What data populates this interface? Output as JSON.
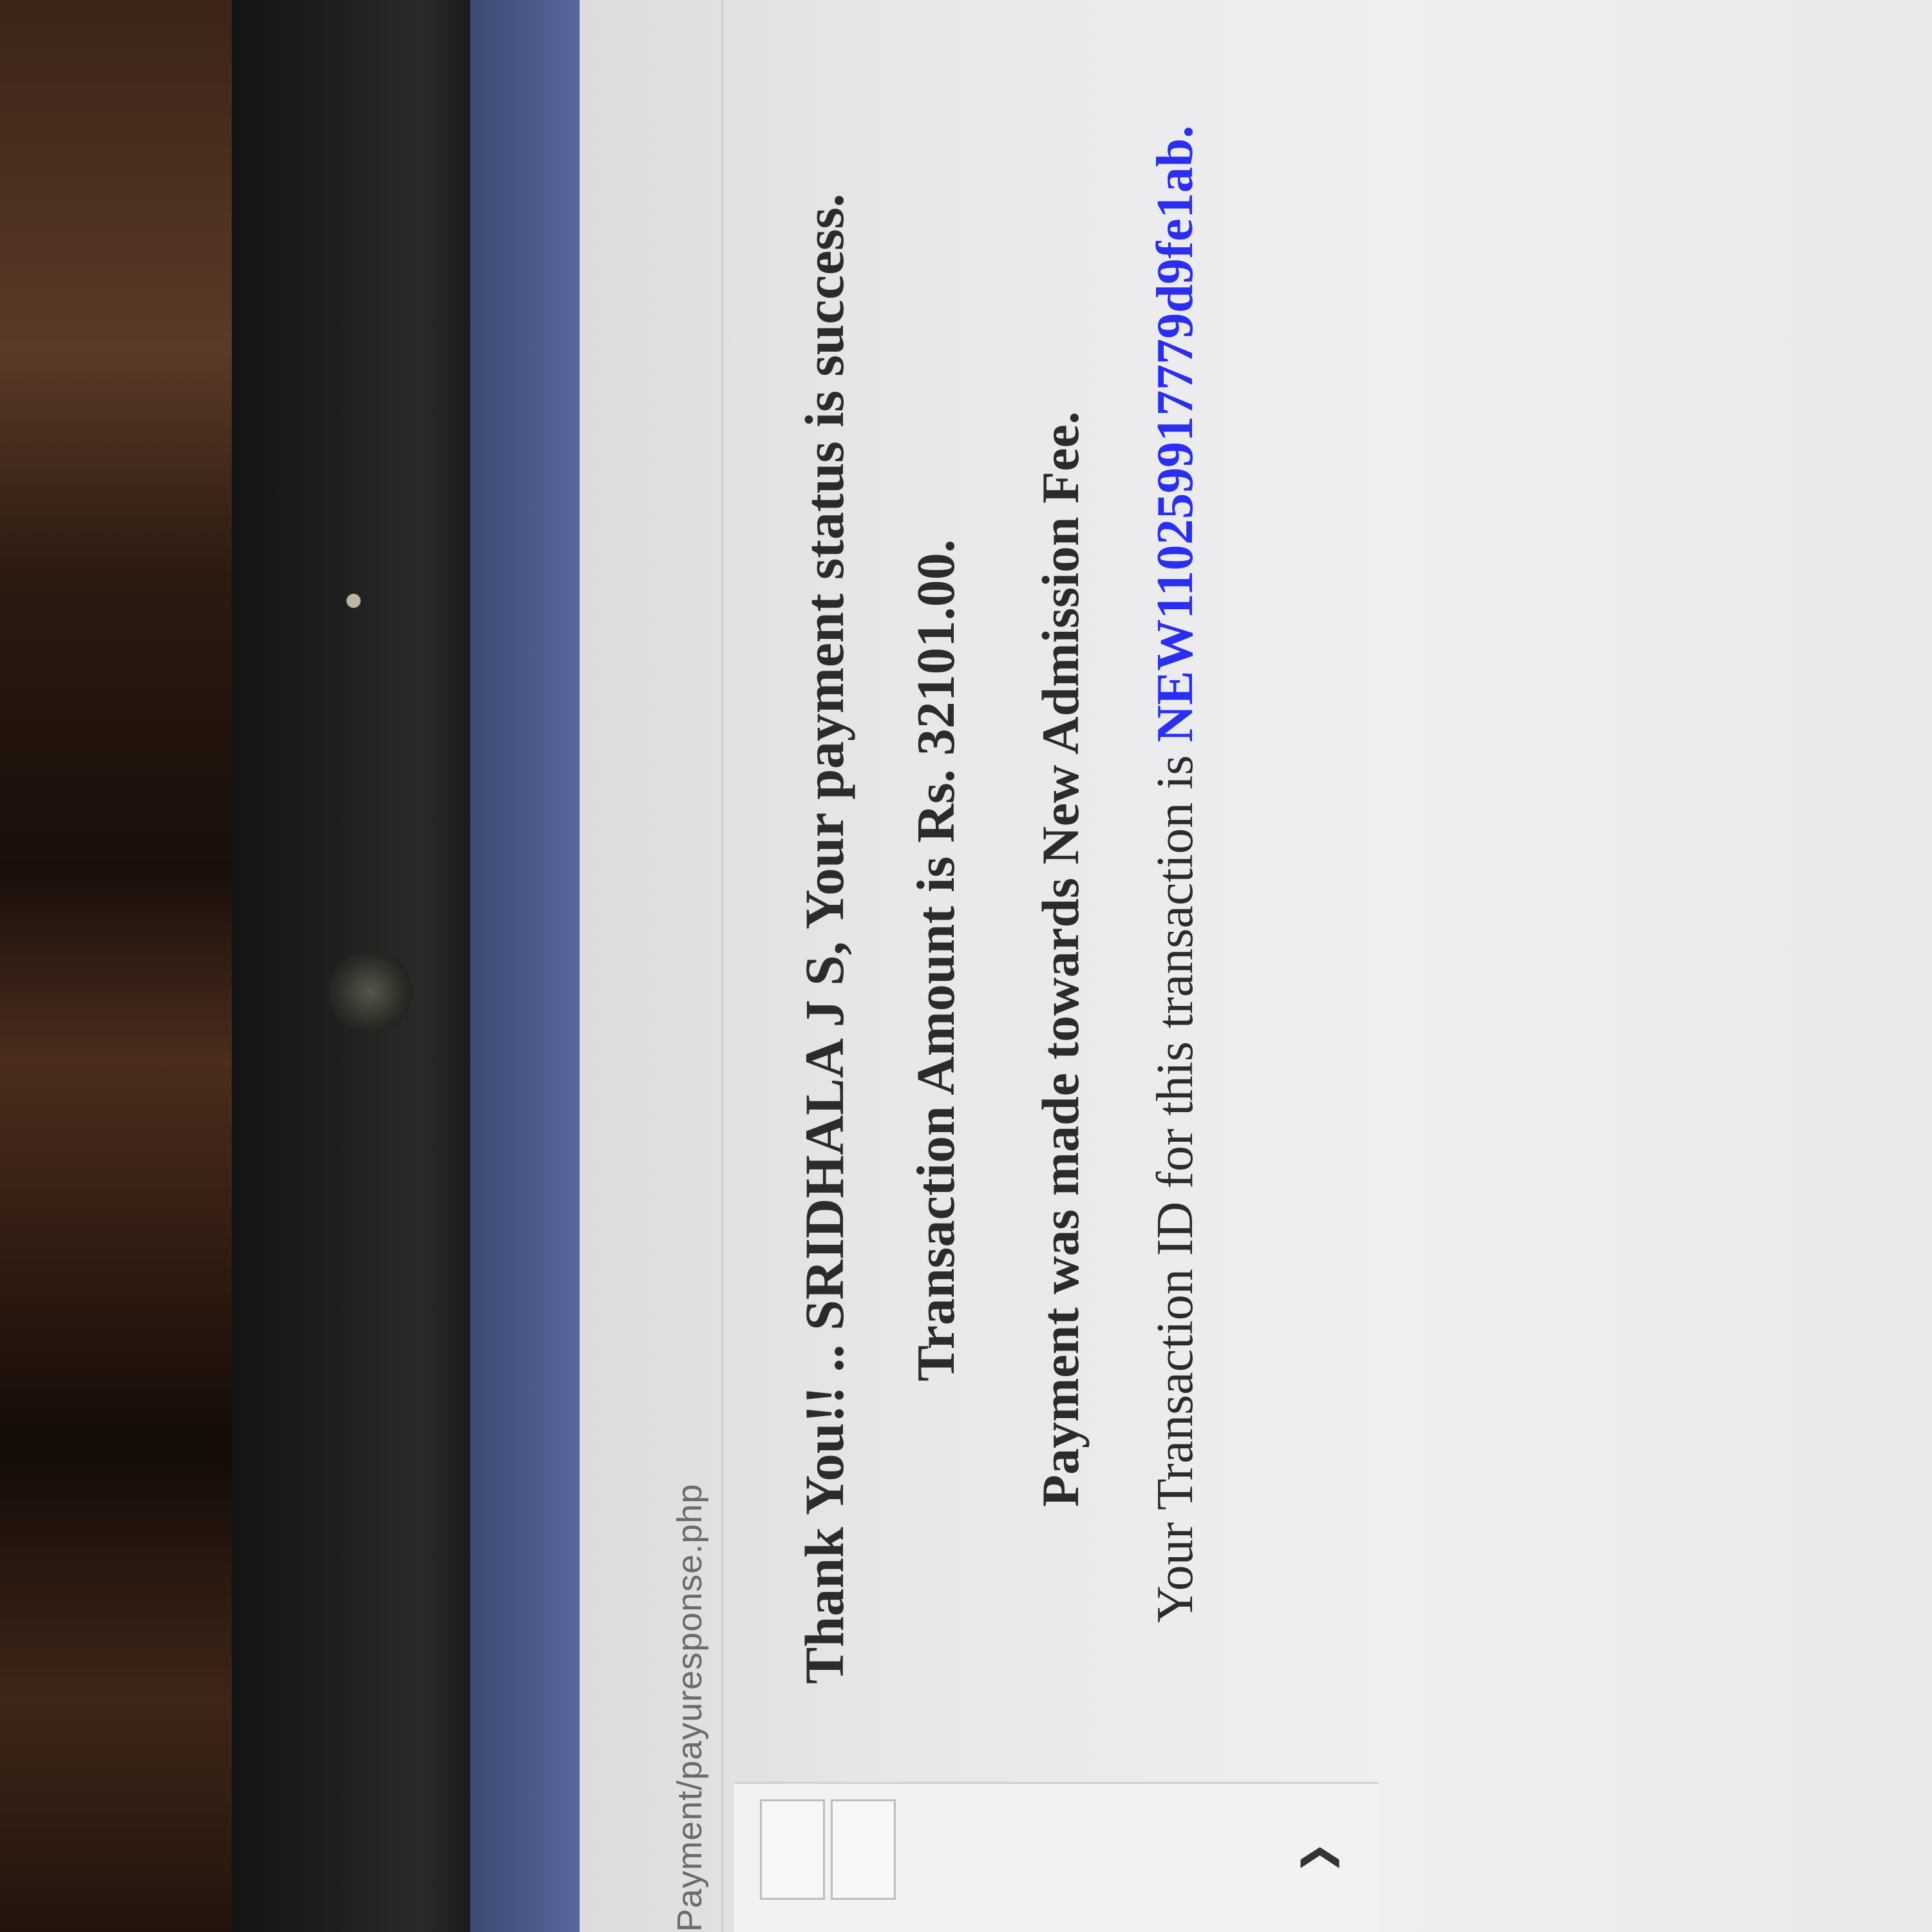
{
  "browser": {
    "url": "Payment/payuresponse.php"
  },
  "message": {
    "line1": "Thank You!! .. SRIDHALA J S, Your payment status is success.",
    "line2": "Transaction Amount is Rs. 32101.00.",
    "line3": "Payment was made towards New Admission Fee.",
    "line4_prefix": "Your Transaction ID for this transaction is ",
    "transaction_id": "NEW110259917779d9fe1ab."
  },
  "colors": {
    "text": "#2b2b2b",
    "transaction_id": "#2a2ef0",
    "chrome_strip": "#4d5a8a"
  },
  "icons": {
    "chevron": "chevron-right-icon"
  }
}
